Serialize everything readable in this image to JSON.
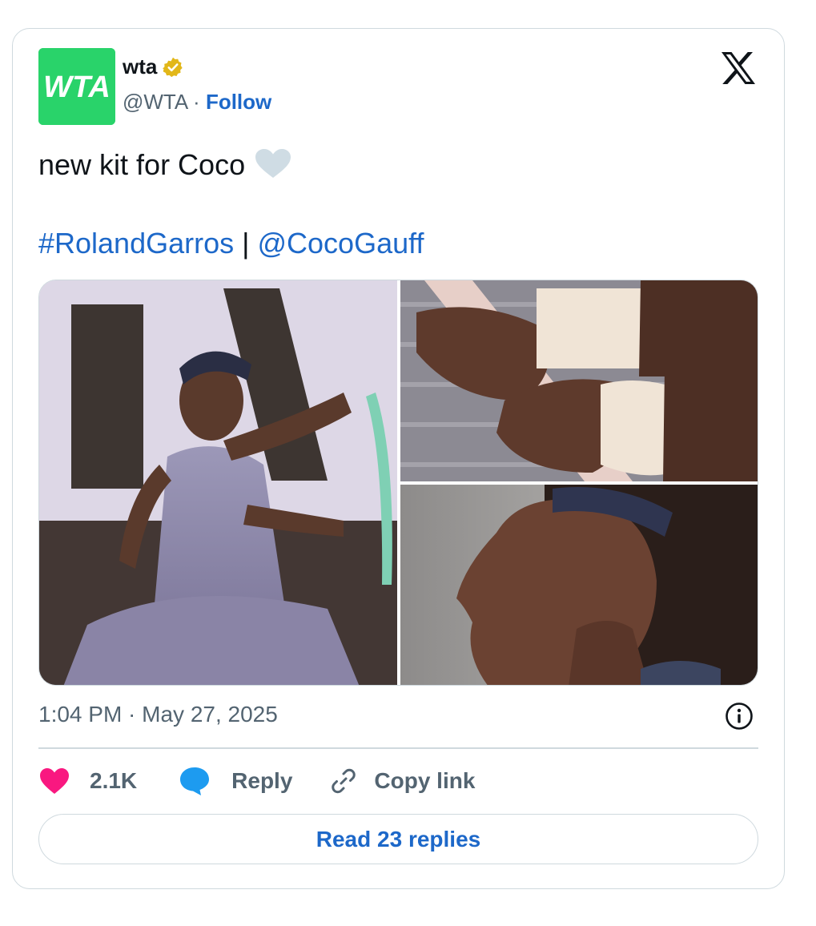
{
  "account": {
    "name": "wta",
    "handle": "@WTA",
    "separator": "·",
    "follow_label": "Follow",
    "avatar_text": "WTA",
    "avatar_color": "#29d36a",
    "verified_badge_color": "#e2b719"
  },
  "tweet": {
    "text": "new kit for Coco",
    "emoji": "white-heart",
    "hashtag": "#RolandGarros",
    "separator": " | ",
    "mention": "@CocoGauff"
  },
  "media": [
    {
      "description_icon": "photo-coco-forehand"
    },
    {
      "description_icon": "photo-wristband-grip"
    },
    {
      "description_icon": "photo-coco-profile"
    }
  ],
  "timestamp": "1:04 PM · May 27, 2025",
  "actions": {
    "like_count": "2.1K",
    "reply_label": "Reply",
    "copy_label": "Copy link"
  },
  "read_replies_label": "Read 23 replies",
  "colors": {
    "link": "#1d68c9",
    "like": "#f91880",
    "reply": "#1d9bf0",
    "muted": "#536471",
    "border": "#cfd9de"
  }
}
